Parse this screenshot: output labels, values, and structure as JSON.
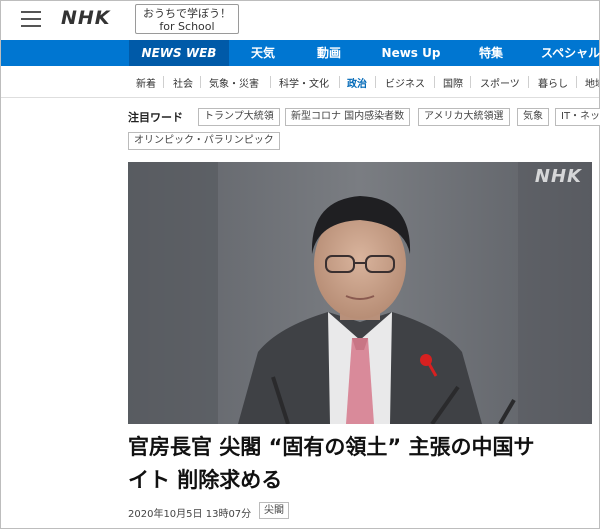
{
  "header": {
    "logo": "NHK",
    "school_line1": "おうちで学ぼう！",
    "school_line2": "for School"
  },
  "nav": {
    "items": [
      "NEWS WEB",
      "天気",
      "動画",
      "News Up",
      "特集",
      "スペシャル"
    ]
  },
  "subnav": {
    "items": [
      "新着",
      "社会",
      "気象・災害",
      "科学・文化",
      "政治",
      "ビジネス",
      "国際",
      "スポーツ",
      "暮らし",
      "地域"
    ],
    "active": "政治"
  },
  "trending": {
    "label": "注目ワード",
    "tags": [
      "トランプ大統領",
      "新型コロナ 国内感染者数",
      "アメリカ大統領選",
      "気象",
      "IT・ネット",
      "オリンピック・パラリンピック"
    ]
  },
  "photo": {
    "watermark": "NHK"
  },
  "article": {
    "headline_line1": "官房長官 尖閣 “固有の領土” 主張の中国サ",
    "headline_line2": "イト 削除求める",
    "date": "2020年10月5日 13時07分",
    "category": "尖閣"
  },
  "colors": {
    "nav_bg": "#0076d1",
    "nav_active_bg": "#005aa8",
    "subnav_active": "#0068b7"
  }
}
